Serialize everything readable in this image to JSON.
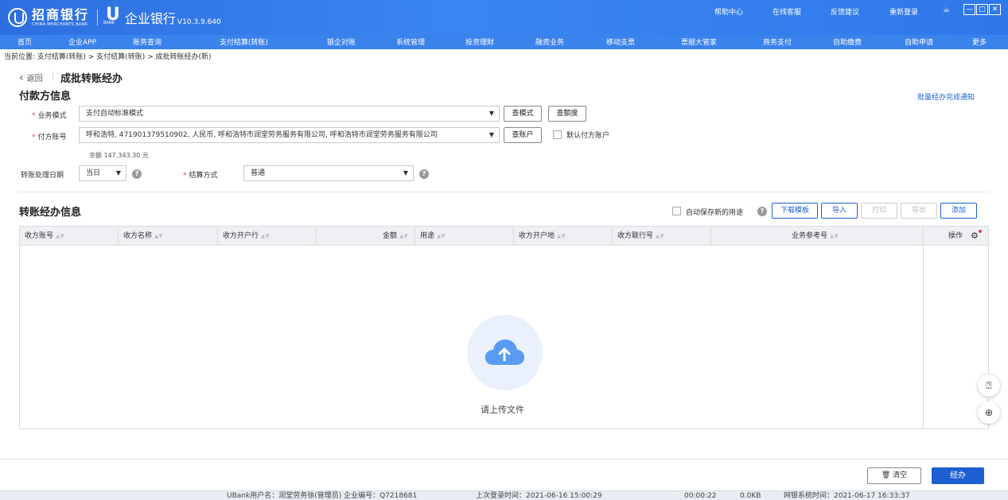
{
  "header": {
    "bank_name": "招商银行",
    "bank_name_en": "CHINA MERCHANTS BANK",
    "ubank_mark": "U",
    "ubank_sub": "BANK",
    "app_name": "企业银行",
    "version": "V10.3.9.640",
    "links": [
      "帮助中心",
      "在线客服",
      "反馈建议",
      "重新登录"
    ],
    "window_controls": [
      "—",
      "□",
      "✕"
    ]
  },
  "nav": {
    "items": [
      "首页",
      "企业APP",
      "账务查询",
      "支付结算(转账)",
      "银企对账",
      "系统管理",
      "投资理财",
      "融资业务",
      "移动支票",
      "票据大管家",
      "商务支付",
      "自助缴费",
      "自助申请",
      "更多"
    ]
  },
  "breadcrumb": "当前位置: 支付结算(转账) > 支付结算(转账) > 成批转账经办(新)",
  "page": {
    "back_label": "返回",
    "title": "成批转账经办"
  },
  "payer": {
    "section_title": "付款方信息",
    "notice_link": "批量经办完成通知",
    "business_mode_label": "业务模式",
    "business_mode_value": "支付自动标准模式",
    "btn_view_mode": "查模式",
    "btn_view_quota": "查额度",
    "account_label": "付方账号",
    "account_value": "呼和浩特, 471901379510902, 人民币, 呼和浩特市润堂劳务服务有限公司, 呼和浩特市润堂劳务服务有限公司",
    "btn_view_account": "查账户",
    "default_account_label": "默认付方账户",
    "balance": "余额 147,343.30 元",
    "date_label": "转账处理日期",
    "date_value": "当日",
    "settle_label": "结算方式",
    "settle_value": "普通"
  },
  "transfer": {
    "section_title": "转账经办信息",
    "auto_save_label": "自动保存新的用途",
    "buttons": {
      "download_template": "下载模板",
      "import": "导入",
      "print": "打印",
      "export": "导出",
      "add": "添加"
    },
    "columns": [
      "收方账号",
      "收方名称",
      "收方开户行",
      "金额",
      "用途",
      "收方开户地",
      "收方联行号",
      "业务参考号",
      "操作"
    ],
    "empty_text": "请上传文件"
  },
  "footer": {
    "clear_label": "清空",
    "submit_label": "经办"
  },
  "status": {
    "user": "UBank用户名：润堂劳务徐(管理员) 企业编号：Q7218681",
    "last_login": "上次登录时间：2021-06-16 15:00:29",
    "timer": "00:00:22",
    "size": "0.0KB",
    "sys_time": "网银系统时间：2021-06-17 16:33:37"
  },
  "colors": {
    "brand_blue": "#2d6fe0",
    "primary_button": "#1d5fd0",
    "required": "#e04040"
  },
  "icons": [
    "bank-logo-icon",
    "ubank-logo-icon",
    "mug-icon",
    "back-chevron-icon",
    "help-icon",
    "sort-icon",
    "gear-icon",
    "upload-cloud-icon",
    "feedback-icon",
    "zoom-icon",
    "trash-icon",
    "dropdown-arrow-icon"
  ]
}
